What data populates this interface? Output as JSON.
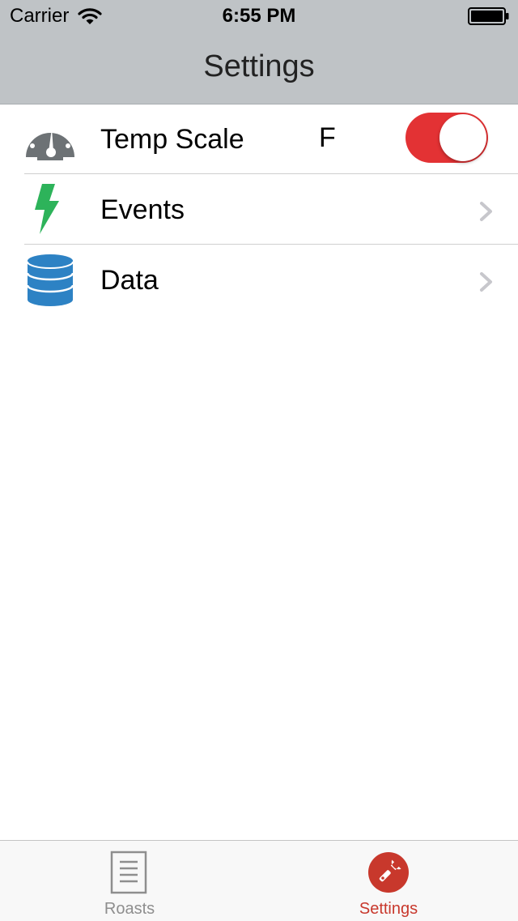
{
  "status_bar": {
    "carrier": "Carrier",
    "time": "6:55 PM"
  },
  "nav": {
    "title": "Settings"
  },
  "rows": [
    {
      "label": "Temp Scale",
      "value": "F",
      "icon": "gauge-icon",
      "toggle_on": true
    },
    {
      "label": "Events",
      "icon": "lightning-bolt-icon"
    },
    {
      "label": "Data",
      "icon": "database-icon"
    }
  ],
  "tab_bar": {
    "tabs": [
      {
        "label": "Roasts",
        "icon": "document-icon",
        "selected": false
      },
      {
        "label": "Settings",
        "icon": "wrench-icon",
        "selected": true
      }
    ]
  },
  "colors": {
    "accent": "#c8382c",
    "toggle_on": "#e33234",
    "header_bg": "#bfc3c6",
    "tab_inactive": "#8e8e8e",
    "bolt": "#2db35a",
    "database": "#2d82c4",
    "gauge": "#6d7275"
  }
}
